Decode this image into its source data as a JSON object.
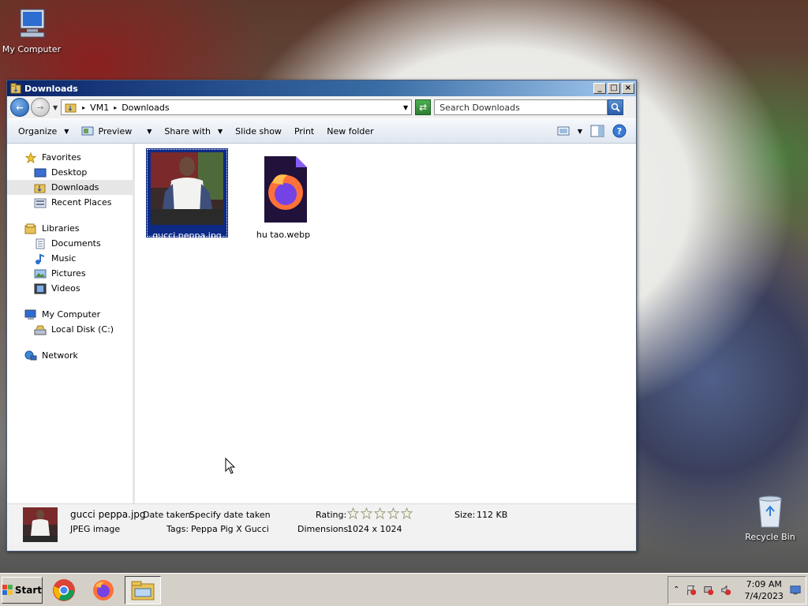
{
  "desktop": {
    "icons": [
      {
        "label": "My Computer"
      },
      {
        "label": "Recycle Bin"
      }
    ]
  },
  "window": {
    "title": "Downloads",
    "address": {
      "crumbs": [
        "VM1",
        "Downloads"
      ]
    },
    "search_placeholder": "Search Downloads",
    "toolbar": {
      "organize": "Organize",
      "preview": "Preview",
      "share_with": "Share with",
      "slide_show": "Slide show",
      "print": "Print",
      "new_folder": "New folder"
    },
    "nav": {
      "favorites": {
        "label": "Favorites",
        "items": [
          "Desktop",
          "Downloads",
          "Recent Places"
        ]
      },
      "libraries": {
        "label": "Libraries",
        "items": [
          "Documents",
          "Music",
          "Pictures",
          "Videos"
        ]
      },
      "computer": {
        "label": "My Computer",
        "items": [
          "Local Disk (C:)"
        ]
      },
      "network": {
        "label": "Network"
      }
    },
    "files": [
      {
        "name": "gucci peppa.jpg",
        "icon": "image-thumbnail",
        "selected": true
      },
      {
        "name": "hu tao.webp",
        "icon": "firefox-document-icon",
        "selected": false
      }
    ],
    "details": {
      "filename": "gucci peppa.jpg",
      "type": "JPEG image",
      "date_taken_label": "Date taken:",
      "date_taken_value": "Specify date taken",
      "tags_label": "Tags:",
      "tags_value": "Peppa Pig X Gucci",
      "rating_label": "Rating:",
      "dimensions_label": "Dimensions:",
      "dimensions_value": "1024 x 1024",
      "size_label": "Size:",
      "size_value": "112 KB"
    }
  },
  "taskbar": {
    "start": "Start",
    "apps": [
      "chrome-icon",
      "firefox-icon",
      "file-explorer-icon"
    ],
    "clock": {
      "time": "7:09 AM",
      "date": "7/4/2023"
    }
  },
  "colors": {
    "selection": "#0c2a86",
    "titlebar": "#0a246a",
    "nav_selected": "#e6e6e6"
  }
}
